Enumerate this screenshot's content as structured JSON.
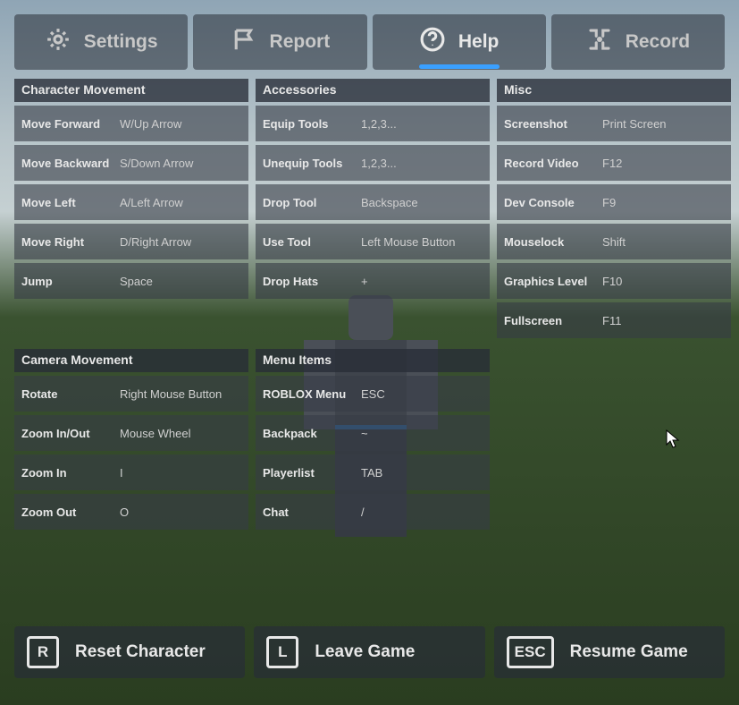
{
  "tabs": {
    "settings": "Settings",
    "report": "Report",
    "help": "Help",
    "record": "Record",
    "active": "help"
  },
  "sections": {
    "character_movement": {
      "title": "Character Movement",
      "rows": [
        {
          "label": "Move Forward",
          "value": "W/Up Arrow"
        },
        {
          "label": "Move Backward",
          "value": "S/Down Arrow"
        },
        {
          "label": "Move Left",
          "value": "A/Left Arrow"
        },
        {
          "label": "Move Right",
          "value": "D/Right Arrow"
        },
        {
          "label": "Jump",
          "value": "Space"
        }
      ]
    },
    "camera_movement": {
      "title": "Camera Movement",
      "rows": [
        {
          "label": "Rotate",
          "value": "Right Mouse Button"
        },
        {
          "label": "Zoom In/Out",
          "value": "Mouse Wheel"
        },
        {
          "label": "Zoom In",
          "value": "I"
        },
        {
          "label": "Zoom Out",
          "value": "O"
        }
      ]
    },
    "accessories": {
      "title": "Accessories",
      "rows": [
        {
          "label": "Equip Tools",
          "value": "1,2,3..."
        },
        {
          "label": "Unequip Tools",
          "value": "1,2,3..."
        },
        {
          "label": "Drop Tool",
          "value": "Backspace"
        },
        {
          "label": "Use Tool",
          "value": "Left Mouse Button"
        },
        {
          "label": "Drop Hats",
          "value": "+"
        }
      ]
    },
    "menu_items": {
      "title": "Menu Items",
      "rows": [
        {
          "label": "ROBLOX Menu",
          "value": "ESC"
        },
        {
          "label": "Backpack",
          "value": "~"
        },
        {
          "label": "Playerlist",
          "value": "TAB"
        },
        {
          "label": "Chat",
          "value": "/"
        }
      ]
    },
    "misc": {
      "title": "Misc",
      "rows": [
        {
          "label": "Screenshot",
          "value": "Print Screen"
        },
        {
          "label": "Record Video",
          "value": "F12"
        },
        {
          "label": "Dev Console",
          "value": "F9"
        },
        {
          "label": "Mouselock",
          "value": "Shift"
        },
        {
          "label": "Graphics Level",
          "value": "F10"
        },
        {
          "label": "Fullscreen",
          "value": "F11"
        }
      ]
    }
  },
  "bottom": {
    "reset": {
      "key": "R",
      "label": "Reset Character"
    },
    "leave": {
      "key": "L",
      "label": "Leave Game"
    },
    "resume": {
      "key": "ESC",
      "label": "Resume Game"
    }
  }
}
